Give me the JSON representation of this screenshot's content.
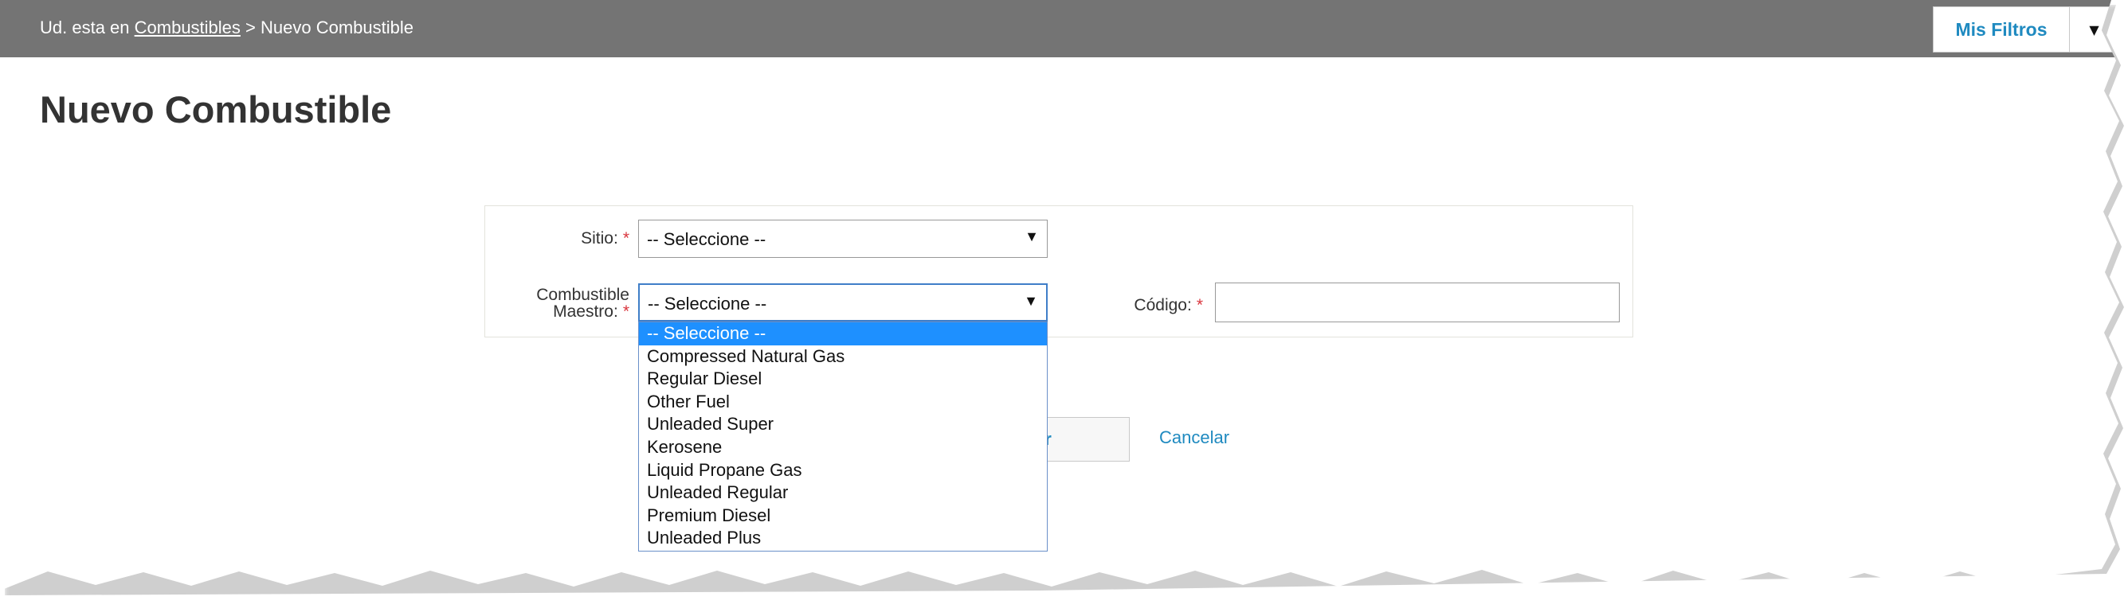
{
  "breadcrumb": {
    "prefix": "Ud. esta en ",
    "link": "Combustibles",
    "separator": " > ",
    "current": "Nuevo Combustible"
  },
  "filters": {
    "label": "Mis Filtros",
    "caret_icon": "caret-down-icon"
  },
  "page_title": "Nuevo Combustible",
  "form": {
    "sitio": {
      "label": "Sitio:",
      "required": "*",
      "value": "-- Seleccione --"
    },
    "combustible_maestro": {
      "label_line1": "Combustible",
      "label_line2": "Maestro:",
      "required": "*",
      "value": "-- Seleccione --",
      "options": [
        "-- Seleccione --",
        "Compressed Natural Gas",
        "Regular Diesel",
        "Other Fuel",
        "Unleaded Super",
        "Kerosene",
        "Liquid Propane Gas",
        "Unleaded Regular",
        "Premium Diesel",
        "Unleaded Plus"
      ],
      "selected_index": 0
    },
    "codigo": {
      "label": "Código:",
      "required": "*",
      "value": ""
    }
  },
  "actions": {
    "save_partial": "ar",
    "cancel": "Cancelar"
  },
  "colors": {
    "topbar": "#747474",
    "link": "#1f8ac0",
    "selected": "#1e90ff",
    "required": "#d9363e"
  }
}
